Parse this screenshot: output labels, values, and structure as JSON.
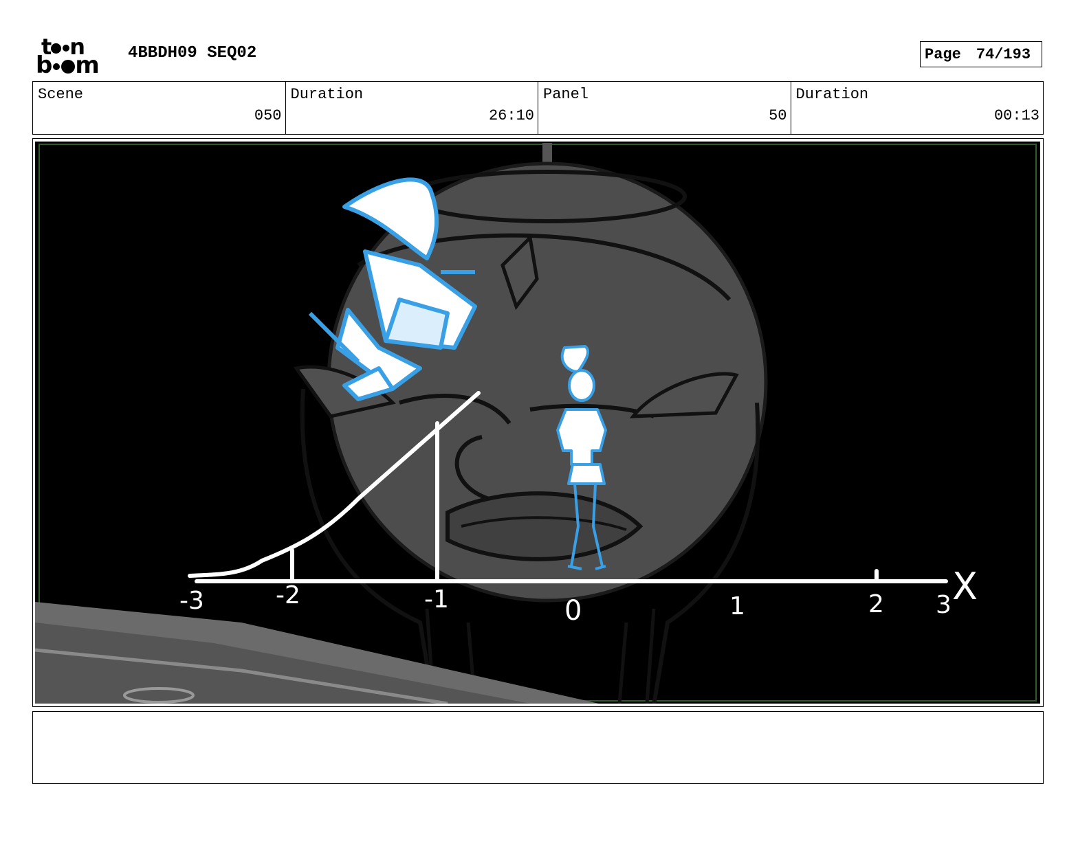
{
  "header": {
    "logo_top": "toon",
    "logo_bottom": "boom",
    "project": "4BBDH09 SEQ02",
    "page_label": "Page",
    "page_value": "74/193"
  },
  "info": {
    "scene_label": "Scene",
    "scene_value": "050",
    "duration_label": "Duration",
    "duration_value": "26:10",
    "panel_label": "Panel",
    "panel_value": "50",
    "panel_duration_label": "Duration",
    "panel_duration_value": "00:13"
  },
  "drawing": {
    "axis_name": "X",
    "tick_labels": [
      "-3",
      "-2",
      "-1",
      "0",
      "1",
      "2",
      "3"
    ]
  },
  "notes": {
    "text": ""
  }
}
